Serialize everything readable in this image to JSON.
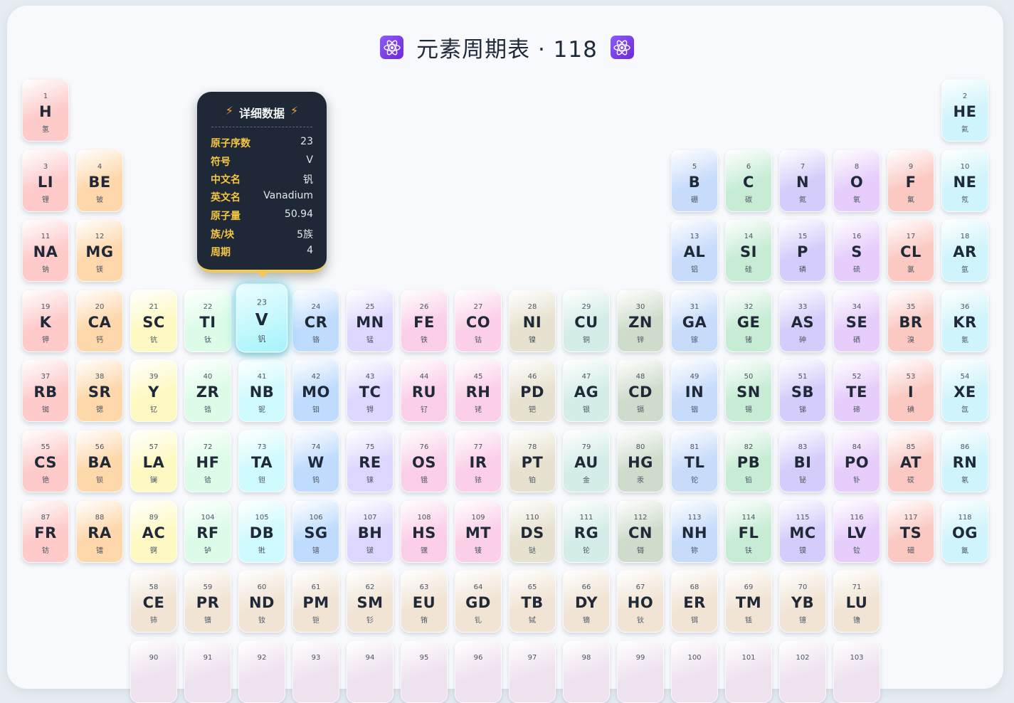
{
  "title": {
    "text": "元素周期表 · 118",
    "left_icon": "atom-icon",
    "right_icon": "atom-icon"
  },
  "colors": {
    "alkali": "#fecaca",
    "alkaline": "#fed7aa",
    "group3": "#fef9c3",
    "group4": "#dcfce7",
    "group5": "#cffafe",
    "group6": "#bfdbfe",
    "group7": "#ddd6fe",
    "group8": "#fbcfe8",
    "group9": "#fbcfe8",
    "group10": "#e7e2cf",
    "group11": "#d5ede8",
    "group12": "#cfdccb",
    "boron": "#c7dbfb",
    "carbon": "#c6ecd4",
    "pnictogen": "#d4ccfa",
    "chalcogen": "#e6cdfb",
    "halogen": "#fbc8c2",
    "noble": "#cff4fb",
    "lanthanide": "#f1e4d4",
    "actinide": "#efe2ef"
  },
  "tooltip": {
    "heading": "详细数据",
    "bolt_icon": "lightning-icon",
    "rows": [
      {
        "key": "原子序数",
        "value": "23"
      },
      {
        "key": "符号",
        "value": "V"
      },
      {
        "key": "中文名",
        "value": "钒"
      },
      {
        "key": "英文名",
        "value": "Vanadium"
      },
      {
        "key": "原子量",
        "value": "50.94"
      },
      {
        "key": "族/块",
        "value": "5族"
      },
      {
        "key": "周期",
        "value": "4"
      }
    ]
  },
  "active_element": "V",
  "elements": [
    {
      "n": "1",
      "s": "H",
      "c": "氢",
      "cat": "alkali",
      "col": 1,
      "row": 1
    },
    {
      "n": "2",
      "s": "HE",
      "c": "氦",
      "cat": "noble",
      "col": 18,
      "row": 1
    },
    {
      "n": "3",
      "s": "LI",
      "c": "锂",
      "cat": "alkali",
      "col": 1,
      "row": 2
    },
    {
      "n": "4",
      "s": "BE",
      "c": "铍",
      "cat": "alkaline",
      "col": 2,
      "row": 2
    },
    {
      "n": "5",
      "s": "B",
      "c": "硼",
      "cat": "boron",
      "col": 13,
      "row": 2
    },
    {
      "n": "6",
      "s": "C",
      "c": "碳",
      "cat": "carbon",
      "col": 14,
      "row": 2
    },
    {
      "n": "7",
      "s": "N",
      "c": "氮",
      "cat": "pnictogen",
      "col": 15,
      "row": 2
    },
    {
      "n": "8",
      "s": "O",
      "c": "氧",
      "cat": "chalcogen",
      "col": 16,
      "row": 2
    },
    {
      "n": "9",
      "s": "F",
      "c": "氟",
      "cat": "halogen",
      "col": 17,
      "row": 2
    },
    {
      "n": "10",
      "s": "NE",
      "c": "氖",
      "cat": "noble",
      "col": 18,
      "row": 2
    },
    {
      "n": "11",
      "s": "NA",
      "c": "钠",
      "cat": "alkali",
      "col": 1,
      "row": 3
    },
    {
      "n": "12",
      "s": "MG",
      "c": "镁",
      "cat": "alkaline",
      "col": 2,
      "row": 3
    },
    {
      "n": "13",
      "s": "AL",
      "c": "铝",
      "cat": "boron",
      "col": 13,
      "row": 3
    },
    {
      "n": "14",
      "s": "SI",
      "c": "硅",
      "cat": "carbon",
      "col": 14,
      "row": 3
    },
    {
      "n": "15",
      "s": "P",
      "c": "磷",
      "cat": "pnictogen",
      "col": 15,
      "row": 3
    },
    {
      "n": "16",
      "s": "S",
      "c": "硫",
      "cat": "chalcogen",
      "col": 16,
      "row": 3
    },
    {
      "n": "17",
      "s": "CL",
      "c": "氯",
      "cat": "halogen",
      "col": 17,
      "row": 3
    },
    {
      "n": "18",
      "s": "AR",
      "c": "氩",
      "cat": "noble",
      "col": 18,
      "row": 3
    },
    {
      "n": "19",
      "s": "K",
      "c": "钾",
      "cat": "alkali",
      "col": 1,
      "row": 4
    },
    {
      "n": "20",
      "s": "CA",
      "c": "钙",
      "cat": "alkaline",
      "col": 2,
      "row": 4
    },
    {
      "n": "21",
      "s": "SC",
      "c": "钪",
      "cat": "group3",
      "col": 3,
      "row": 4
    },
    {
      "n": "22",
      "s": "TI",
      "c": "钛",
      "cat": "group4",
      "col": 4,
      "row": 4
    },
    {
      "n": "23",
      "s": "V",
      "c": "钒",
      "cat": "group5",
      "col": 5,
      "row": 4
    },
    {
      "n": "24",
      "s": "CR",
      "c": "铬",
      "cat": "group6",
      "col": 6,
      "row": 4
    },
    {
      "n": "25",
      "s": "MN",
      "c": "锰",
      "cat": "group7",
      "col": 7,
      "row": 4
    },
    {
      "n": "26",
      "s": "FE",
      "c": "铁",
      "cat": "group8",
      "col": 8,
      "row": 4
    },
    {
      "n": "27",
      "s": "CO",
      "c": "钴",
      "cat": "group9",
      "col": 9,
      "row": 4
    },
    {
      "n": "28",
      "s": "NI",
      "c": "镍",
      "cat": "group10",
      "col": 10,
      "row": 4
    },
    {
      "n": "29",
      "s": "CU",
      "c": "铜",
      "cat": "group11",
      "col": 11,
      "row": 4
    },
    {
      "n": "30",
      "s": "ZN",
      "c": "锌",
      "cat": "group12",
      "col": 12,
      "row": 4
    },
    {
      "n": "31",
      "s": "GA",
      "c": "镓",
      "cat": "boron",
      "col": 13,
      "row": 4
    },
    {
      "n": "32",
      "s": "GE",
      "c": "锗",
      "cat": "carbon",
      "col": 14,
      "row": 4
    },
    {
      "n": "33",
      "s": "AS",
      "c": "砷",
      "cat": "pnictogen",
      "col": 15,
      "row": 4
    },
    {
      "n": "34",
      "s": "SE",
      "c": "硒",
      "cat": "chalcogen",
      "col": 16,
      "row": 4
    },
    {
      "n": "35",
      "s": "BR",
      "c": "溴",
      "cat": "halogen",
      "col": 17,
      "row": 4
    },
    {
      "n": "36",
      "s": "KR",
      "c": "氪",
      "cat": "noble",
      "col": 18,
      "row": 4
    },
    {
      "n": "37",
      "s": "RB",
      "c": "铷",
      "cat": "alkali",
      "col": 1,
      "row": 5
    },
    {
      "n": "38",
      "s": "SR",
      "c": "锶",
      "cat": "alkaline",
      "col": 2,
      "row": 5
    },
    {
      "n": "39",
      "s": "Y",
      "c": "钇",
      "cat": "group3",
      "col": 3,
      "row": 5
    },
    {
      "n": "40",
      "s": "ZR",
      "c": "锆",
      "cat": "group4",
      "col": 4,
      "row": 5
    },
    {
      "n": "41",
      "s": "NB",
      "c": "铌",
      "cat": "group5",
      "col": 5,
      "row": 5
    },
    {
      "n": "42",
      "s": "MO",
      "c": "钼",
      "cat": "group6",
      "col": 6,
      "row": 5
    },
    {
      "n": "43",
      "s": "TC",
      "c": "锝",
      "cat": "group7",
      "col": 7,
      "row": 5
    },
    {
      "n": "44",
      "s": "RU",
      "c": "钌",
      "cat": "group8",
      "col": 8,
      "row": 5
    },
    {
      "n": "45",
      "s": "RH",
      "c": "铑",
      "cat": "group9",
      "col": 9,
      "row": 5
    },
    {
      "n": "46",
      "s": "PD",
      "c": "钯",
      "cat": "group10",
      "col": 10,
      "row": 5
    },
    {
      "n": "47",
      "s": "AG",
      "c": "银",
      "cat": "group11",
      "col": 11,
      "row": 5
    },
    {
      "n": "48",
      "s": "CD",
      "c": "镉",
      "cat": "group12",
      "col": 12,
      "row": 5
    },
    {
      "n": "49",
      "s": "IN",
      "c": "铟",
      "cat": "boron",
      "col": 13,
      "row": 5
    },
    {
      "n": "50",
      "s": "SN",
      "c": "锡",
      "cat": "carbon",
      "col": 14,
      "row": 5
    },
    {
      "n": "51",
      "s": "SB",
      "c": "锑",
      "cat": "pnictogen",
      "col": 15,
      "row": 5
    },
    {
      "n": "52",
      "s": "TE",
      "c": "碲",
      "cat": "chalcogen",
      "col": 16,
      "row": 5
    },
    {
      "n": "53",
      "s": "I",
      "c": "碘",
      "cat": "halogen",
      "col": 17,
      "row": 5
    },
    {
      "n": "54",
      "s": "XE",
      "c": "氙",
      "cat": "noble",
      "col": 18,
      "row": 5
    },
    {
      "n": "55",
      "s": "CS",
      "c": "铯",
      "cat": "alkali",
      "col": 1,
      "row": 6
    },
    {
      "n": "56",
      "s": "BA",
      "c": "钡",
      "cat": "alkaline",
      "col": 2,
      "row": 6
    },
    {
      "n": "57",
      "s": "LA",
      "c": "镧",
      "cat": "group3",
      "col": 3,
      "row": 6
    },
    {
      "n": "72",
      "s": "HF",
      "c": "铪",
      "cat": "group4",
      "col": 4,
      "row": 6
    },
    {
      "n": "73",
      "s": "TA",
      "c": "钽",
      "cat": "group5",
      "col": 5,
      "row": 6
    },
    {
      "n": "74",
      "s": "W",
      "c": "钨",
      "cat": "group6",
      "col": 6,
      "row": 6
    },
    {
      "n": "75",
      "s": "RE",
      "c": "铼",
      "cat": "group7",
      "col": 7,
      "row": 6
    },
    {
      "n": "76",
      "s": "OS",
      "c": "锇",
      "cat": "group8",
      "col": 8,
      "row": 6
    },
    {
      "n": "77",
      "s": "IR",
      "c": "铱",
      "cat": "group9",
      "col": 9,
      "row": 6
    },
    {
      "n": "78",
      "s": "PT",
      "c": "铂",
      "cat": "group10",
      "col": 10,
      "row": 6
    },
    {
      "n": "79",
      "s": "AU",
      "c": "金",
      "cat": "group11",
      "col": 11,
      "row": 6
    },
    {
      "n": "80",
      "s": "HG",
      "c": "汞",
      "cat": "group12",
      "col": 12,
      "row": 6
    },
    {
      "n": "81",
      "s": "TL",
      "c": "铊",
      "cat": "boron",
      "col": 13,
      "row": 6
    },
    {
      "n": "82",
      "s": "PB",
      "c": "铅",
      "cat": "carbon",
      "col": 14,
      "row": 6
    },
    {
      "n": "83",
      "s": "BI",
      "c": "铋",
      "cat": "pnictogen",
      "col": 15,
      "row": 6
    },
    {
      "n": "84",
      "s": "PO",
      "c": "钋",
      "cat": "chalcogen",
      "col": 16,
      "row": 6
    },
    {
      "n": "85",
      "s": "AT",
      "c": "砹",
      "cat": "halogen",
      "col": 17,
      "row": 6
    },
    {
      "n": "86",
      "s": "RN",
      "c": "氡",
      "cat": "noble",
      "col": 18,
      "row": 6
    },
    {
      "n": "87",
      "s": "FR",
      "c": "钫",
      "cat": "alkali",
      "col": 1,
      "row": 7
    },
    {
      "n": "88",
      "s": "RA",
      "c": "镭",
      "cat": "alkaline",
      "col": 2,
      "row": 7
    },
    {
      "n": "89",
      "s": "AC",
      "c": "锕",
      "cat": "group3",
      "col": 3,
      "row": 7
    },
    {
      "n": "104",
      "s": "RF",
      "c": "𬬻",
      "cat": "group4",
      "col": 4,
      "row": 7
    },
    {
      "n": "105",
      "s": "DB",
      "c": "𬭊",
      "cat": "group5",
      "col": 5,
      "row": 7
    },
    {
      "n": "106",
      "s": "SG",
      "c": "𬭳",
      "cat": "group6",
      "col": 6,
      "row": 7
    },
    {
      "n": "107",
      "s": "BH",
      "c": "𬭛",
      "cat": "group7",
      "col": 7,
      "row": 7
    },
    {
      "n": "108",
      "s": "HS",
      "c": "𬭶",
      "cat": "group8",
      "col": 8,
      "row": 7
    },
    {
      "n": "109",
      "s": "MT",
      "c": "鿏",
      "cat": "group9",
      "col": 9,
      "row": 7
    },
    {
      "n": "110",
      "s": "DS",
      "c": "𫟼",
      "cat": "group10",
      "col": 10,
      "row": 7
    },
    {
      "n": "111",
      "s": "RG",
      "c": "𬬭",
      "cat": "group11",
      "col": 11,
      "row": 7
    },
    {
      "n": "112",
      "s": "CN",
      "c": "鿔",
      "cat": "group12",
      "col": 12,
      "row": 7
    },
    {
      "n": "113",
      "s": "NH",
      "c": "鿭",
      "cat": "boron",
      "col": 13,
      "row": 7
    },
    {
      "n": "114",
      "s": "FL",
      "c": "𫓧",
      "cat": "carbon",
      "col": 14,
      "row": 7
    },
    {
      "n": "115",
      "s": "MC",
      "c": "镆",
      "cat": "pnictogen",
      "col": 15,
      "row": 7
    },
    {
      "n": "116",
      "s": "LV",
      "c": "𫟷",
      "cat": "chalcogen",
      "col": 16,
      "row": 7
    },
    {
      "n": "117",
      "s": "TS",
      "c": "鿬",
      "cat": "halogen",
      "col": 17,
      "row": 7
    },
    {
      "n": "118",
      "s": "OG",
      "c": "鿫",
      "cat": "noble",
      "col": 18,
      "row": 7
    },
    {
      "n": "58",
      "s": "CE",
      "c": "铈",
      "cat": "lanthanide",
      "col": 3,
      "row": 8
    },
    {
      "n": "59",
      "s": "PR",
      "c": "镨",
      "cat": "lanthanide",
      "col": 4,
      "row": 8
    },
    {
      "n": "60",
      "s": "ND",
      "c": "钕",
      "cat": "lanthanide",
      "col": 5,
      "row": 8
    },
    {
      "n": "61",
      "s": "PM",
      "c": "钷",
      "cat": "lanthanide",
      "col": 6,
      "row": 8
    },
    {
      "n": "62",
      "s": "SM",
      "c": "钐",
      "cat": "lanthanide",
      "col": 7,
      "row": 8
    },
    {
      "n": "63",
      "s": "EU",
      "c": "铕",
      "cat": "lanthanide",
      "col": 8,
      "row": 8
    },
    {
      "n": "64",
      "s": "GD",
      "c": "钆",
      "cat": "lanthanide",
      "col": 9,
      "row": 8
    },
    {
      "n": "65",
      "s": "TB",
      "c": "铽",
      "cat": "lanthanide",
      "col": 10,
      "row": 8
    },
    {
      "n": "66",
      "s": "DY",
      "c": "镝",
      "cat": "lanthanide",
      "col": 11,
      "row": 8
    },
    {
      "n": "67",
      "s": "HO",
      "c": "钬",
      "cat": "lanthanide",
      "col": 12,
      "row": 8
    },
    {
      "n": "68",
      "s": "ER",
      "c": "铒",
      "cat": "lanthanide",
      "col": 13,
      "row": 8
    },
    {
      "n": "69",
      "s": "TM",
      "c": "铥",
      "cat": "lanthanide",
      "col": 14,
      "row": 8
    },
    {
      "n": "70",
      "s": "YB",
      "c": "镱",
      "cat": "lanthanide",
      "col": 15,
      "row": 8
    },
    {
      "n": "71",
      "s": "LU",
      "c": "镥",
      "cat": "lanthanide",
      "col": 16,
      "row": 8
    },
    {
      "n": "90",
      "s": "",
      "c": "",
      "cat": "actinide",
      "col": 3,
      "row": 9
    },
    {
      "n": "91",
      "s": "",
      "c": "",
      "cat": "actinide",
      "col": 4,
      "row": 9
    },
    {
      "n": "92",
      "s": "",
      "c": "",
      "cat": "actinide",
      "col": 5,
      "row": 9
    },
    {
      "n": "93",
      "s": "",
      "c": "",
      "cat": "actinide",
      "col": 6,
      "row": 9
    },
    {
      "n": "94",
      "s": "",
      "c": "",
      "cat": "actinide",
      "col": 7,
      "row": 9
    },
    {
      "n": "95",
      "s": "",
      "c": "",
      "cat": "actinide",
      "col": 8,
      "row": 9
    },
    {
      "n": "96",
      "s": "",
      "c": "",
      "cat": "actinide",
      "col": 9,
      "row": 9
    },
    {
      "n": "97",
      "s": "",
      "c": "",
      "cat": "actinide",
      "col": 10,
      "row": 9
    },
    {
      "n": "98",
      "s": "",
      "c": "",
      "cat": "actinide",
      "col": 11,
      "row": 9
    },
    {
      "n": "99",
      "s": "",
      "c": "",
      "cat": "actinide",
      "col": 12,
      "row": 9
    },
    {
      "n": "100",
      "s": "",
      "c": "",
      "cat": "actinide",
      "col": 13,
      "row": 9
    },
    {
      "n": "101",
      "s": "",
      "c": "",
      "cat": "actinide",
      "col": 14,
      "row": 9
    },
    {
      "n": "102",
      "s": "",
      "c": "",
      "cat": "actinide",
      "col": 15,
      "row": 9
    },
    {
      "n": "103",
      "s": "",
      "c": "",
      "cat": "actinide",
      "col": 16,
      "row": 9
    }
  ]
}
